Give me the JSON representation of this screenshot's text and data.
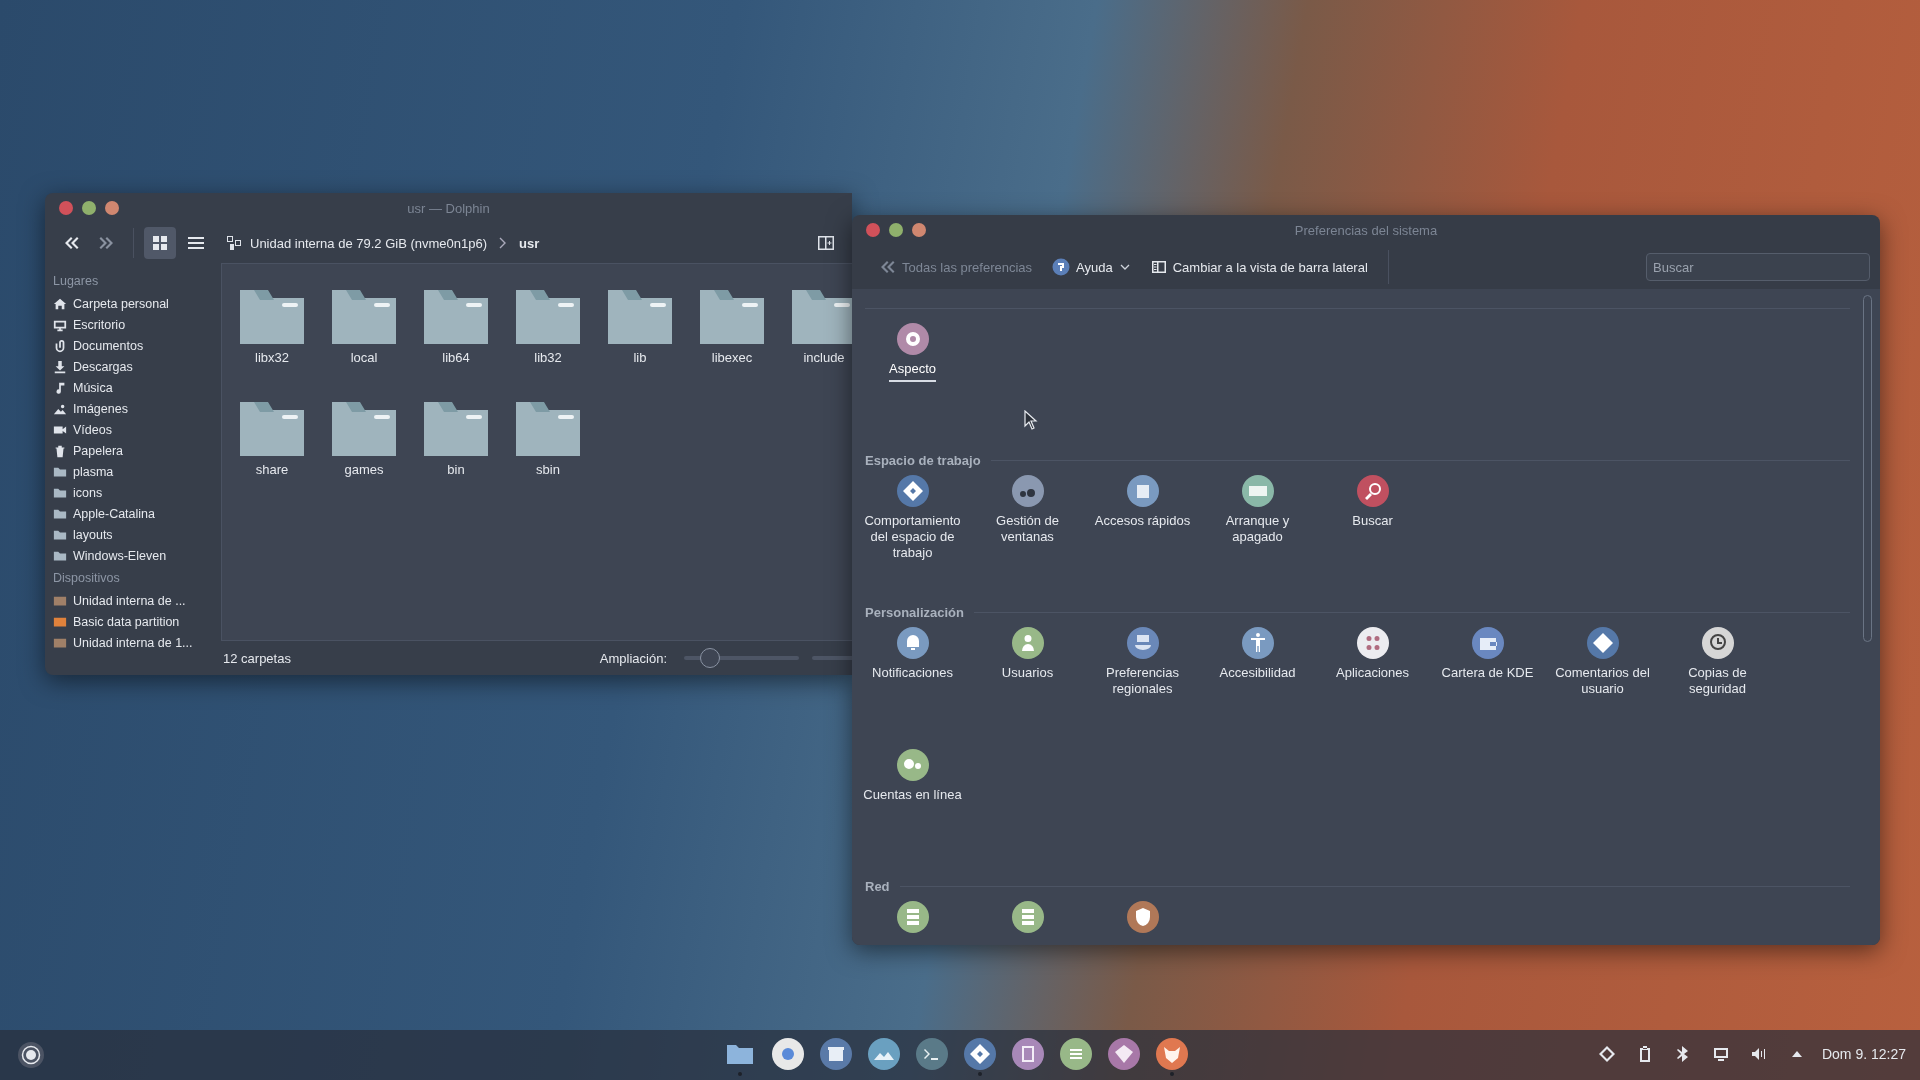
{
  "dolphin": {
    "title": "usr — Dolphin",
    "nav": [
      {
        "kind": "back",
        "disabled": false
      },
      {
        "kind": "forward",
        "disabled": true
      }
    ],
    "view_modes": [
      {
        "kind": "icons",
        "selected": true
      },
      {
        "kind": "details",
        "selected": false
      }
    ],
    "breadcrumb": [
      {
        "label": "Unidad interna de 79.2 GiB (nvme0n1p6)",
        "current": false
      },
      {
        "label": "usr",
        "current": true
      }
    ],
    "sidebar": [
      {
        "heading": "Lugares",
        "items": [
          {
            "kind": "home",
            "label": "Carpeta personal"
          },
          {
            "kind": "desktop",
            "label": "Escritorio"
          },
          {
            "kind": "documents",
            "label": "Documentos"
          },
          {
            "kind": "downloads",
            "label": "Descargas"
          },
          {
            "kind": "music",
            "label": "Música"
          },
          {
            "kind": "pictures",
            "label": "Imágenes"
          },
          {
            "kind": "videos",
            "label": "Vídeos"
          },
          {
            "kind": "trash",
            "label": "Papelera"
          },
          {
            "kind": "folder",
            "label": "plasma"
          },
          {
            "kind": "folder",
            "label": "icons"
          },
          {
            "kind": "folder",
            "label": "Apple-Catalina"
          },
          {
            "kind": "folder",
            "label": "layouts"
          },
          {
            "kind": "folder",
            "label": "Windows-Eleven"
          }
        ]
      },
      {
        "heading": "Dispositivos",
        "items": [
          {
            "kind": "drive",
            "label": "Unidad interna de ..."
          },
          {
            "kind": "partition",
            "label": "Basic data partition"
          },
          {
            "kind": "drive",
            "label": "Unidad interna de 1..."
          }
        ]
      }
    ],
    "folders": [
      "libx32",
      "local",
      "lib64",
      "lib32",
      "lib",
      "libexec",
      "include",
      "share",
      "games",
      "bin",
      "sbin"
    ],
    "status_bar": {
      "count": "12 carpetas",
      "zoom_label": "Ampliación:",
      "zoom": {
        "level": 0.25
      }
    }
  },
  "preferences": {
    "title": "Preferencias del sistema",
    "back": {
      "label": "Todas las preferencias",
      "disabled": true
    },
    "help": "Ayuda",
    "sidebar_view": "Cambiar a la vista de barra lateral",
    "search": {
      "placeholder": "Buscar"
    },
    "sections": [
      {
        "items": [
          {
            "kind": "appearance",
            "label": "Aspecto",
            "selected": true
          }
        ]
      },
      {
        "title": "Espacio de trabajo",
        "items": [
          {
            "kind": "workspace",
            "label": "Comportamiento del espacio de trabajo",
            "selected": false
          },
          {
            "kind": "windows",
            "label": "Gestión de ventanas",
            "selected": false
          },
          {
            "kind": "shortcuts",
            "label": "Accesos rápidos",
            "selected": false
          },
          {
            "kind": "startup",
            "label": "Arranque y apagado",
            "selected": false
          },
          {
            "kind": "search",
            "label": "Buscar",
            "selected": false
          }
        ]
      },
      {
        "title": "Personalización",
        "items": [
          {
            "kind": "notifications",
            "label": "Notificaciones",
            "selected": false
          },
          {
            "kind": "users",
            "label": "Usuarios",
            "selected": false
          },
          {
            "kind": "regional",
            "label": "Preferencias regionales",
            "selected": false
          },
          {
            "kind": "accessibility",
            "label": "Accesibilidad",
            "selected": false
          },
          {
            "kind": "applications",
            "label": "Aplicaciones",
            "selected": false
          },
          {
            "kind": "wallet",
            "label": "Cartera de KDE",
            "selected": false
          },
          {
            "kind": "feedback",
            "label": "Comentarios del usuario",
            "selected": false
          },
          {
            "kind": "backup",
            "label": "Copias de seguridad",
            "selected": false
          },
          {
            "kind": "online",
            "label": "Cuentas en línea",
            "selected": false
          }
        ]
      },
      {
        "title": "Red",
        "items": [
          {
            "kind": "server",
            "selected": false
          },
          {
            "kind": "server",
            "selected": false
          },
          {
            "kind": "shield",
            "selected": false
          }
        ]
      }
    ]
  },
  "taskbar": {
    "dock": [
      {
        "kind": "files",
        "running": true
      },
      {
        "kind": "browser",
        "running": false
      },
      {
        "kind": "store",
        "running": false
      },
      {
        "kind": "photos",
        "running": false
      },
      {
        "kind": "terminal",
        "running": false
      },
      {
        "kind": "settings",
        "running": true
      },
      {
        "kind": "book",
        "running": false
      },
      {
        "kind": "notes",
        "running": false
      },
      {
        "kind": "kite",
        "running": false
      },
      {
        "kind": "fox",
        "running": true
      }
    ],
    "tray": [
      {
        "kind": "connect"
      },
      {
        "kind": "clipboard"
      },
      {
        "kind": "bluetooth"
      },
      {
        "kind": "display"
      },
      {
        "kind": "volume"
      },
      {
        "kind": "expand"
      }
    ],
    "clock": "Dom 9. 12:27"
  }
}
